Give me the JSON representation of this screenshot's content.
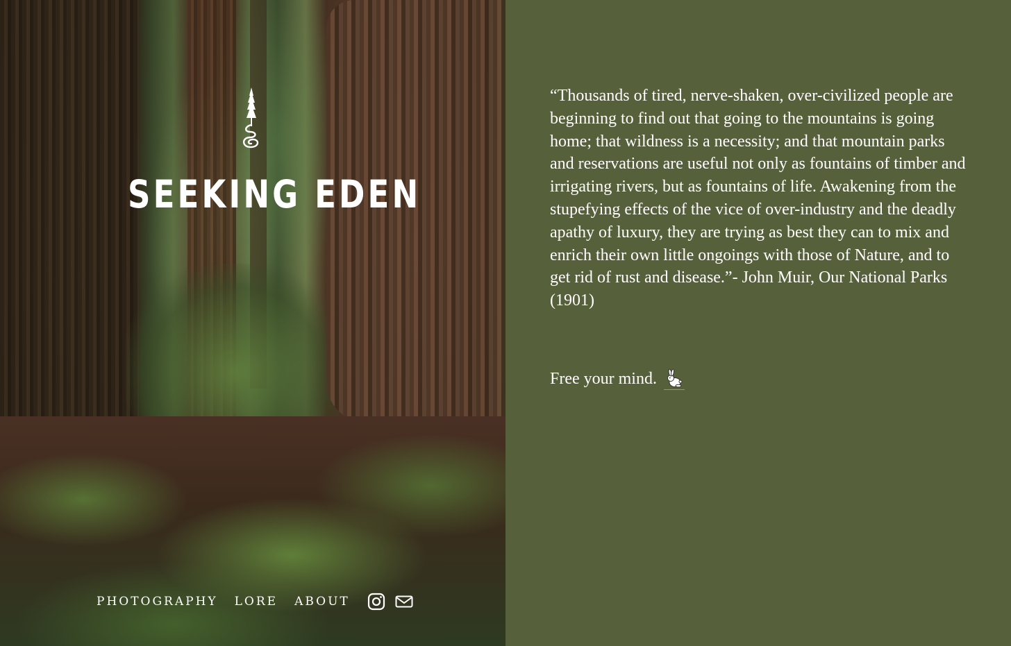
{
  "site": {
    "title": "SEEKING EDEN",
    "logo_icon": "redwood-tree-spiral-icon"
  },
  "nav": {
    "items": [
      {
        "label": "PHOTOGRAPHY"
      },
      {
        "label": "LORE"
      },
      {
        "label": "ABOUT"
      }
    ],
    "icons": [
      "instagram-icon",
      "mail-icon"
    ]
  },
  "content": {
    "quote": "“Thousands of tired, nerve-shaken, over-civilized people are beginning to find out that going to the mountains is going home; that wildness is a necessity; and that mountain parks and reservations are useful not only as fountains of timber and irrigating rivers, but as fountains of life. Awakening from the stupefying effects of the vice of over-industry and the deadly apathy of luxury, they are trying as best they can to mix and enrich their own little ongoings with those of Nature, and to get rid of rust and disease.”- John Muir, Our National Parks (1901)",
    "tagline": "Free your mind.",
    "tagline_icon": "rabbit-icon"
  },
  "colors": {
    "panel_background": "#56603a",
    "text": "#ffffff"
  }
}
